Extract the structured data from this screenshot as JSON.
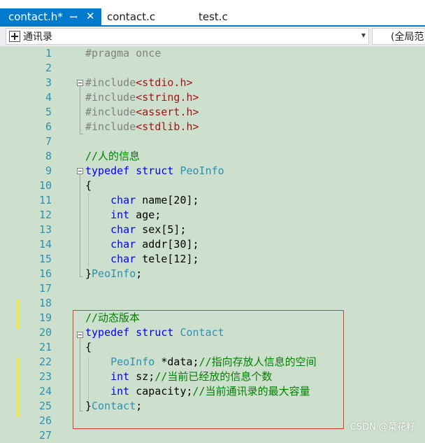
{
  "tabs": [
    {
      "label": "contact.h*",
      "active": true
    },
    {
      "label": "contact.c",
      "active": false
    },
    {
      "label": "test.c",
      "active": false
    }
  ],
  "tab_pin_glyph": "ꟷ",
  "tab_close_glyph": "✕",
  "nav": {
    "scope_left": "通讯录",
    "scope_right": "(全局范"
  },
  "line_numbers": [
    "1",
    "2",
    "3",
    "4",
    "5",
    "6",
    "7",
    "8",
    "9",
    "10",
    "11",
    "12",
    "13",
    "14",
    "15",
    "16",
    "17",
    "18",
    "19",
    "20",
    "21",
    "22",
    "23",
    "24",
    "25",
    "26",
    "27"
  ],
  "code": {
    "l1": "#pragma once",
    "l3_a": "#include",
    "l3_b": "<stdio.h>",
    "l4_a": "#include",
    "l4_b": "<string.h>",
    "l5_a": "#include",
    "l5_b": "<assert.h>",
    "l6_a": "#include",
    "l6_b": "<stdlib.h>",
    "l8": "//人的信息",
    "l9_kw": "typedef struct",
    "l9_ty": "PeoInfo",
    "l10": "{",
    "l11_kw": "char",
    "l11_rest": " name[20];",
    "l12_kw": "int",
    "l12_rest": " age;",
    "l13_kw": "char",
    "l13_rest": " sex[5];",
    "l14_kw": "char",
    "l14_rest": " addr[30];",
    "l15_kw": "char",
    "l15_rest": " tele[12];",
    "l16_a": "}",
    "l16_ty": "PeoInfo",
    "l16_b": ";",
    "l19": "//动态版本",
    "l20_kw": "typedef struct",
    "l20_ty": "Contact",
    "l21": "{",
    "l22_ty": "PeoInfo",
    "l22_rest": " *data;",
    "l22_cm": "//指向存放人信息的空间",
    "l23_kw": "int",
    "l23_rest": " sz;",
    "l23_cm": "//当前已经放的信息个数",
    "l24_kw": "int",
    "l24_rest": " capacity;",
    "l24_cm": "//当前通讯录的最大容量",
    "l25_a": "}",
    "l25_ty": "Contact",
    "l25_b": ";"
  },
  "watermark": "CSDN @菜花籽",
  "colors": {
    "editor_bg": "#cde0cd",
    "keyword": "#0000ff",
    "type": "#2b91af",
    "include_path": "#a31515",
    "comment": "#008000",
    "active_tab": "#007acc",
    "highlight_box": "#e53935"
  }
}
